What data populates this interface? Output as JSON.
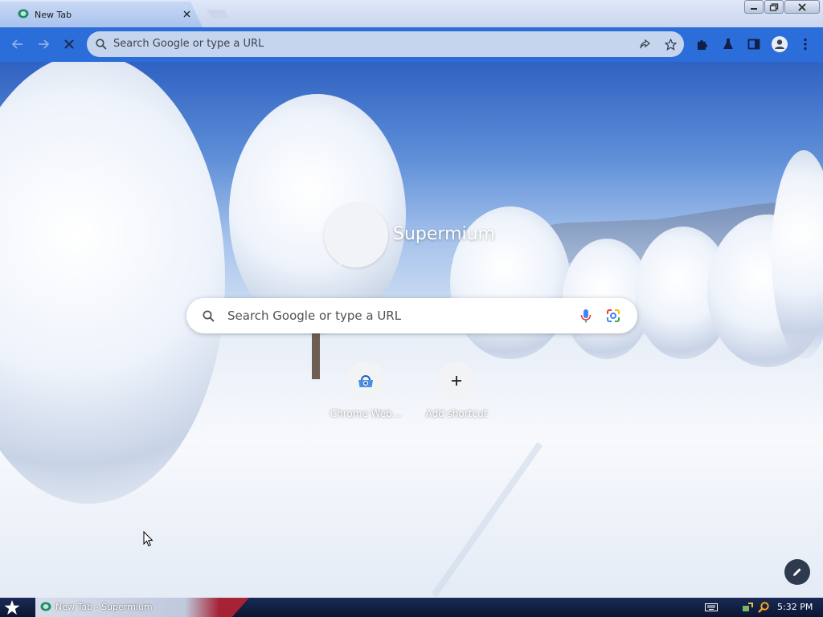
{
  "tab": {
    "title": "New Tab",
    "close_icon": "close-icon",
    "favicon": "supermium-favicon"
  },
  "window_controls": [
    "minimize-icon",
    "restore-icon",
    "close-icon"
  ],
  "toolbar": {
    "back_icon": "arrow-left-icon",
    "forward_icon": "arrow-right-icon",
    "stop_icon": "stop-x-icon",
    "omnibox_placeholder": "Search Google or type a URL",
    "share_icon": "share-icon",
    "bookmark_icon": "star-icon",
    "extensions_icon": "puzzle-icon",
    "labs_icon": "flask-icon",
    "sidepanel_icon": "side-panel-icon",
    "profile_icon": "avatar-icon",
    "menu_icon": "kebab-menu-icon"
  },
  "ntp": {
    "brand": "Supermium",
    "search_placeholder": "Search Google or type a URL",
    "shortcuts": [
      {
        "label": "Chrome Web...",
        "icon": "chrome-web-store-icon"
      },
      {
        "label": "Add shortcut",
        "icon": "plus-icon"
      }
    ],
    "customize_icon": "pencil-icon"
  },
  "taskbar": {
    "task_label": "New Tab - Supermium",
    "clock": "5:32 PM"
  },
  "colors": {
    "toolbar": "#2b6dd9",
    "omnibox": "#c6d5ee",
    "taskbar": "#0c1633"
  }
}
